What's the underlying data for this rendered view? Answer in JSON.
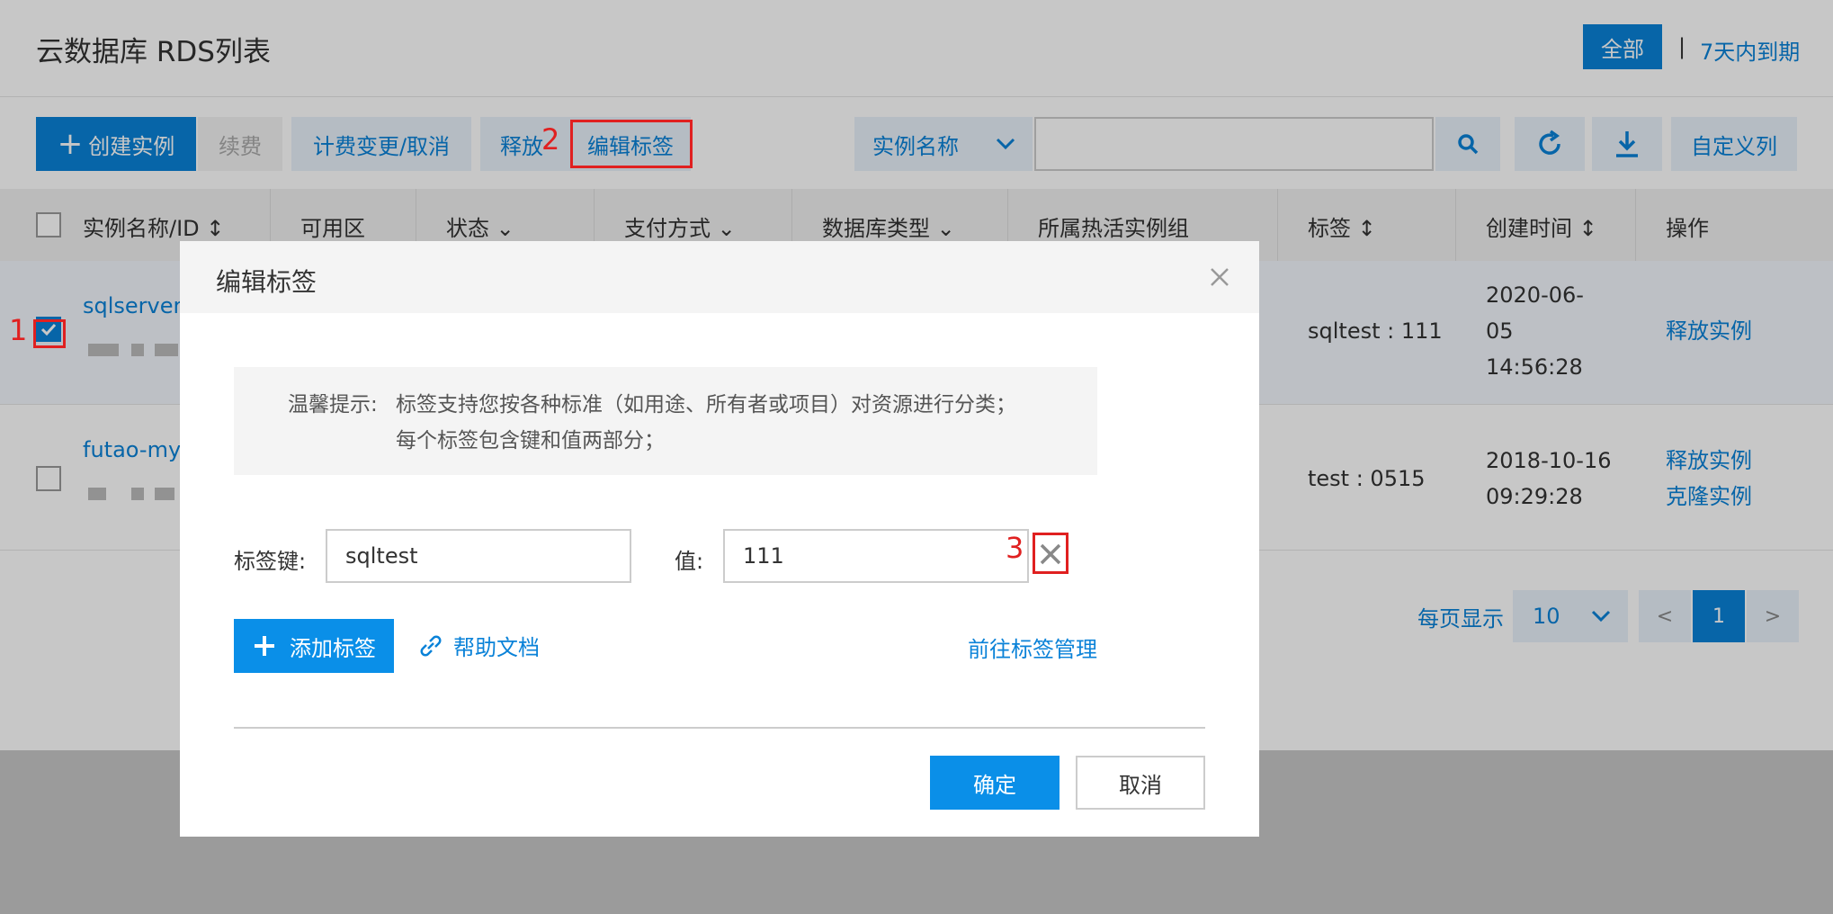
{
  "header": {
    "title": "云数据库 RDS列表",
    "filter_all": "全部",
    "separator": "|",
    "filter_expire": "7天内到期"
  },
  "toolbar": {
    "create_label": "创建实例",
    "renew_label": "续费",
    "billing_label": "计费变更/取消",
    "release_label": "释放",
    "edit_tags_label": "编辑标签",
    "search_field": "实例名称",
    "custom_columns_label": "自定义列"
  },
  "table": {
    "columns": [
      "实例名称/ID",
      "可用区",
      "状态",
      "支付方式",
      "数据库类型",
      "所属热活实例组",
      "标签",
      "创建时间",
      "操作"
    ],
    "rows": [
      {
        "name": "sqlserver",
        "tag": "sqltest : 111",
        "created_line1": "2020-06-",
        "created_line2": "05",
        "created_line3": "14:56:28",
        "action1": "释放实例",
        "checked": true
      },
      {
        "name": "futao-mys",
        "tag": "test : 0515",
        "created_line1": "2018-10-16",
        "created_line2": "09:29:28",
        "action1": "释放实例",
        "action2": "克隆实例",
        "checked": false
      }
    ]
  },
  "pager": {
    "per_page_label": "每页显示",
    "per_page_value": "10",
    "prev": "<",
    "current": "1",
    "next": ">"
  },
  "annotations": {
    "n1": "1",
    "n2": "2",
    "n3": "3"
  },
  "modal": {
    "title": "编辑标签",
    "tip_label": "温馨提示:",
    "tip_line1": "标签支持您按各种标准（如用途、所有者或项目）对资源进行分类；",
    "tip_line2": "每个标签包含键和值两部分；",
    "key_label": "标签键:",
    "key_value": "sqltest",
    "value_label": "值:",
    "value_value": "111",
    "add_tag_label": "添加标签",
    "help_label": "帮助文档",
    "goto_label": "前往标签管理",
    "ok_label": "确定",
    "cancel_label": "取消"
  },
  "colors": {
    "primary": "#0a82d8",
    "annotation": "#e02020"
  }
}
